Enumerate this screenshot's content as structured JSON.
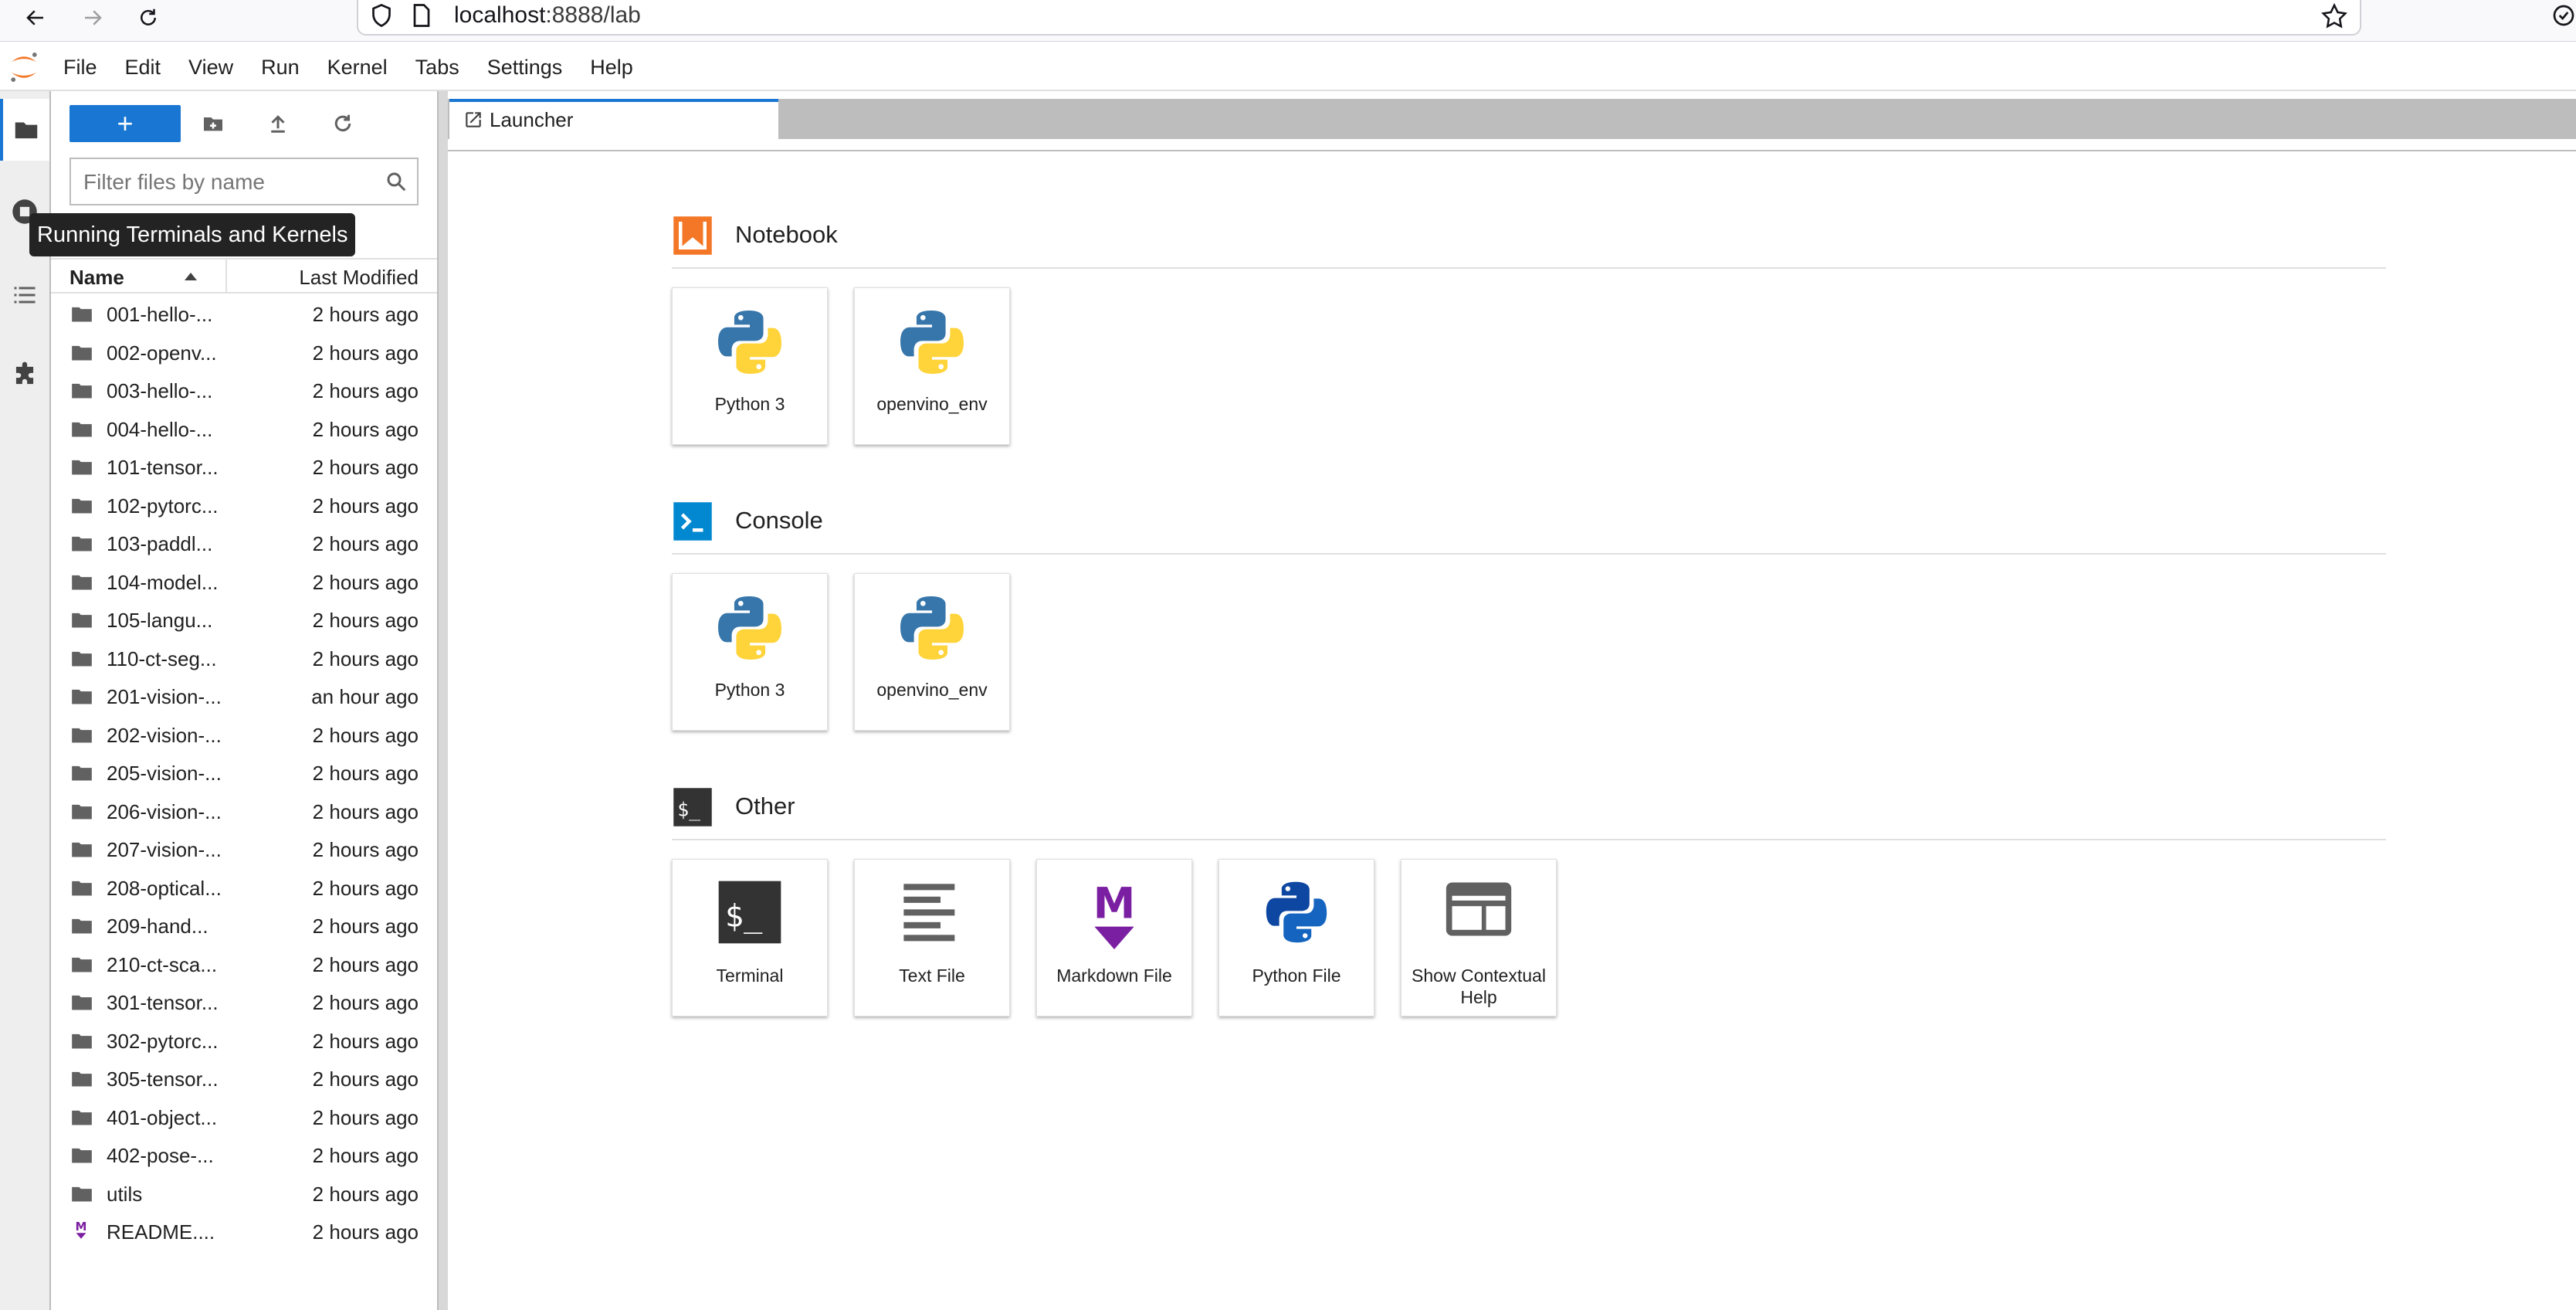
{
  "browser": {
    "url_host": "localhost",
    "url_rest": ":8888/lab"
  },
  "menubar": {
    "items": [
      "File",
      "Edit",
      "View",
      "Run",
      "Kernel",
      "Tabs",
      "Settings",
      "Help"
    ]
  },
  "filebrowser": {
    "new_label": "+",
    "filter_placeholder": "Filter files by name",
    "tooltip": "Running Terminals and Kernels",
    "col_name": "Name",
    "col_modified": "Last Modified",
    "files": [
      {
        "name": "001-hello-...",
        "modified": "2 hours ago",
        "type": "folder"
      },
      {
        "name": "002-openv...",
        "modified": "2 hours ago",
        "type": "folder"
      },
      {
        "name": "003-hello-...",
        "modified": "2 hours ago",
        "type": "folder"
      },
      {
        "name": "004-hello-...",
        "modified": "2 hours ago",
        "type": "folder"
      },
      {
        "name": "101-tensor...",
        "modified": "2 hours ago",
        "type": "folder"
      },
      {
        "name": "102-pytorc...",
        "modified": "2 hours ago",
        "type": "folder"
      },
      {
        "name": "103-paddl...",
        "modified": "2 hours ago",
        "type": "folder"
      },
      {
        "name": "104-model...",
        "modified": "2 hours ago",
        "type": "folder"
      },
      {
        "name": "105-langu...",
        "modified": "2 hours ago",
        "type": "folder"
      },
      {
        "name": "110-ct-seg...",
        "modified": "2 hours ago",
        "type": "folder"
      },
      {
        "name": "201-vision-...",
        "modified": "an hour ago",
        "type": "folder"
      },
      {
        "name": "202-vision-...",
        "modified": "2 hours ago",
        "type": "folder"
      },
      {
        "name": "205-vision-...",
        "modified": "2 hours ago",
        "type": "folder"
      },
      {
        "name": "206-vision-...",
        "modified": "2 hours ago",
        "type": "folder"
      },
      {
        "name": "207-vision-...",
        "modified": "2 hours ago",
        "type": "folder"
      },
      {
        "name": "208-optical...",
        "modified": "2 hours ago",
        "type": "folder"
      },
      {
        "name": "209-hand...",
        "modified": "2 hours ago",
        "type": "folder"
      },
      {
        "name": "210-ct-sca...",
        "modified": "2 hours ago",
        "type": "folder"
      },
      {
        "name": "301-tensor...",
        "modified": "2 hours ago",
        "type": "folder"
      },
      {
        "name": "302-pytorc...",
        "modified": "2 hours ago",
        "type": "folder"
      },
      {
        "name": "305-tensor...",
        "modified": "2 hours ago",
        "type": "folder"
      },
      {
        "name": "401-object...",
        "modified": "2 hours ago",
        "type": "folder"
      },
      {
        "name": "402-pose-...",
        "modified": "2 hours ago",
        "type": "folder"
      },
      {
        "name": "utils",
        "modified": "2 hours ago",
        "type": "folder"
      },
      {
        "name": "README....",
        "modified": "2 hours ago",
        "type": "markdown"
      }
    ]
  },
  "tabs": [
    {
      "label": "Launcher",
      "icon": "launcher-icon"
    }
  ],
  "launcher": {
    "sections": [
      {
        "title": "Notebook",
        "icon": "notebook-icon",
        "cards": [
          {
            "label": "Python 3",
            "icon": "python-logo-icon"
          },
          {
            "label": "openvino_env",
            "icon": "python-logo-icon"
          }
        ]
      },
      {
        "title": "Console",
        "icon": "console-icon",
        "cards": [
          {
            "label": "Python 3",
            "icon": "python-logo-icon"
          },
          {
            "label": "openvino_env",
            "icon": "python-logo-icon"
          }
        ]
      },
      {
        "title": "Other",
        "icon": "terminal-icon",
        "cards": [
          {
            "label": "Terminal",
            "icon": "terminal-icon"
          },
          {
            "label": "Text File",
            "icon": "text-file-icon"
          },
          {
            "label": "Markdown File",
            "icon": "markdown-icon"
          },
          {
            "label": "Python File",
            "icon": "python-file-icon"
          },
          {
            "label": "Show Contextual Help",
            "icon": "contextual-help-icon"
          }
        ]
      }
    ]
  },
  "colors": {
    "accent": "#1976d2",
    "notebook_orange": "#f37726",
    "markdown_purple": "#7b1fa2"
  }
}
